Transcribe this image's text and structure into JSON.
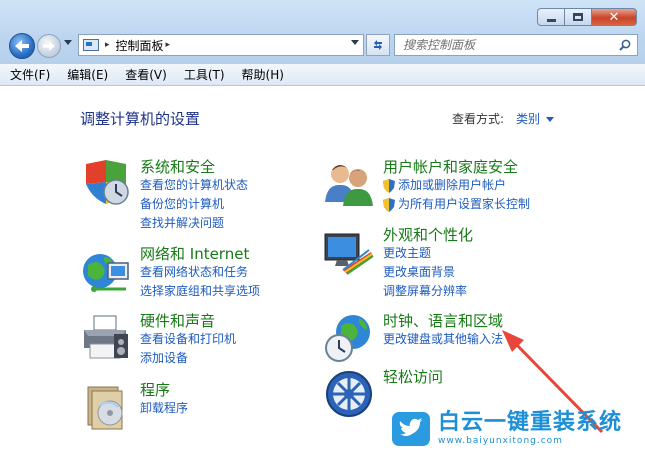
{
  "window": {
    "close_glyph": "✕"
  },
  "address_bar": {
    "breadcrumb": "控制面板",
    "separator": "▸"
  },
  "search": {
    "placeholder": "搜索控制面板"
  },
  "menu": {
    "items": [
      "文件(F)",
      "编辑(E)",
      "查看(V)",
      "工具(T)",
      "帮助(H)"
    ]
  },
  "content": {
    "title": "调整计算机的设置",
    "view_by_label": "查看方式:",
    "view_by_value": "类别"
  },
  "categories": [
    {
      "icon": "shield-flag-icon",
      "title": "系统和安全",
      "links": [
        "查看您的计算机状态",
        "备份您的计算机",
        "查找并解决问题"
      ]
    },
    {
      "icon": "network-globe-icon",
      "title": "网络和 Internet",
      "links": [
        "查看网络状态和任务",
        "选择家庭组和共享选项"
      ]
    },
    {
      "icon": "printer-icon",
      "title": "硬件和声音",
      "links": [
        "查看设备和打印机",
        "添加设备"
      ]
    },
    {
      "icon": "programs-icon",
      "title": "程序",
      "links": [
        "卸载程序"
      ]
    },
    {
      "icon": "users-icon",
      "title": "用户帐户和家庭安全",
      "links": [
        "添加或删除用户帐户",
        "为所有用户设置家长控制"
      ],
      "shield_links": true
    },
    {
      "icon": "monitor-palette-icon",
      "title": "外观和个性化",
      "links": [
        "更改主题",
        "更改桌面背景",
        "调整屏幕分辨率"
      ]
    },
    {
      "icon": "clock-globe-icon",
      "title": "时钟、语言和区域",
      "links": [
        "更改键盘或其他输入法"
      ]
    },
    {
      "icon": "ease-of-access-icon",
      "title": "轻松访问",
      "links": []
    }
  ],
  "watermark": {
    "brand": "白云一键重装系统",
    "url": "www.baiyunxitong.com"
  },
  "colors": {
    "accent_link": "#1e5bbf",
    "category_title": "#177a17",
    "page_title": "#1e3287",
    "annotation_arrow": "#e8463a",
    "watermark": "#1e8fd6"
  }
}
